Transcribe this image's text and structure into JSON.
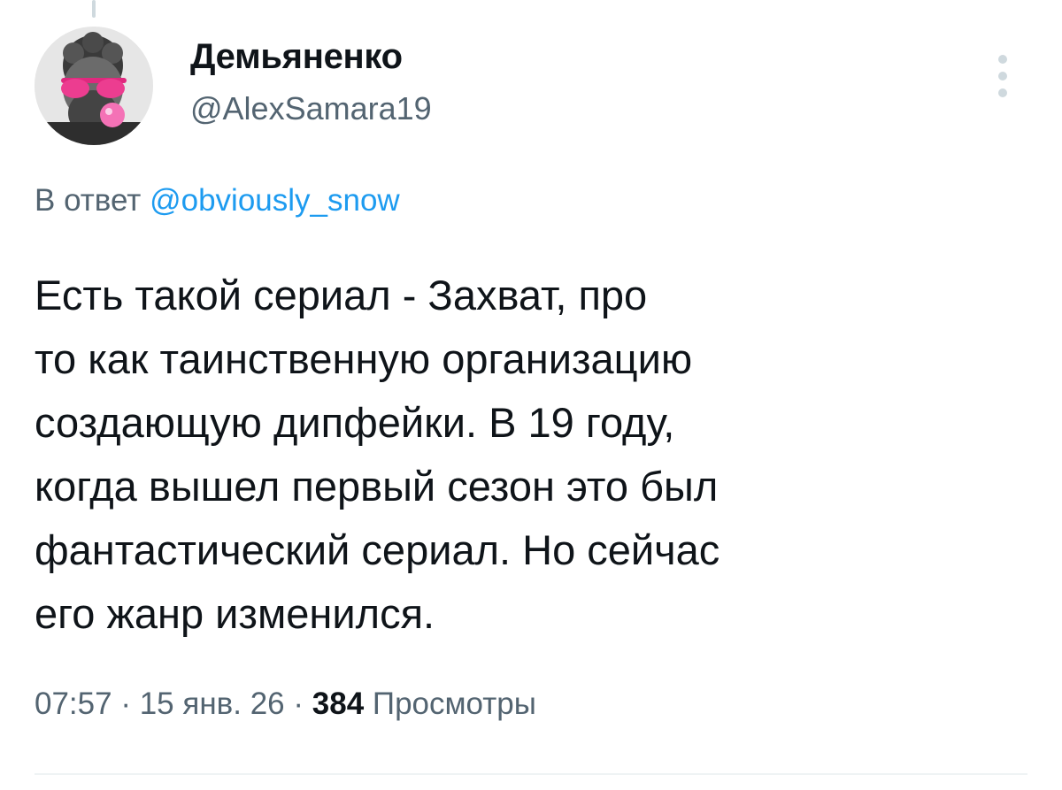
{
  "author": {
    "display_name": "Демьяненко",
    "handle": "@AlexSamara19",
    "avatar_icon": "user-avatar-icon"
  },
  "reply_to": {
    "prefix": "В ответ",
    "mention": "@obviously_snow"
  },
  "tweet": {
    "lines": [
      "Есть такой сериал - Захват, про",
      "то как таинственную организацию",
      "создающую дипфейки. В 19 году,",
      "когда вышел первый сезон это был",
      "фантастический сериал. Но сейчас",
      "его жанр изменился."
    ]
  },
  "meta": {
    "time": "07:57",
    "separator": "·",
    "date": "15 янв. 26",
    "views_count": "384",
    "views_label": "Просмотры"
  },
  "icons": {
    "more": "more-vertical-icon"
  },
  "colors": {
    "text_primary": "#0f1419",
    "text_secondary": "#536471",
    "link": "#1d9bf0",
    "divider": "#eff3f4"
  }
}
